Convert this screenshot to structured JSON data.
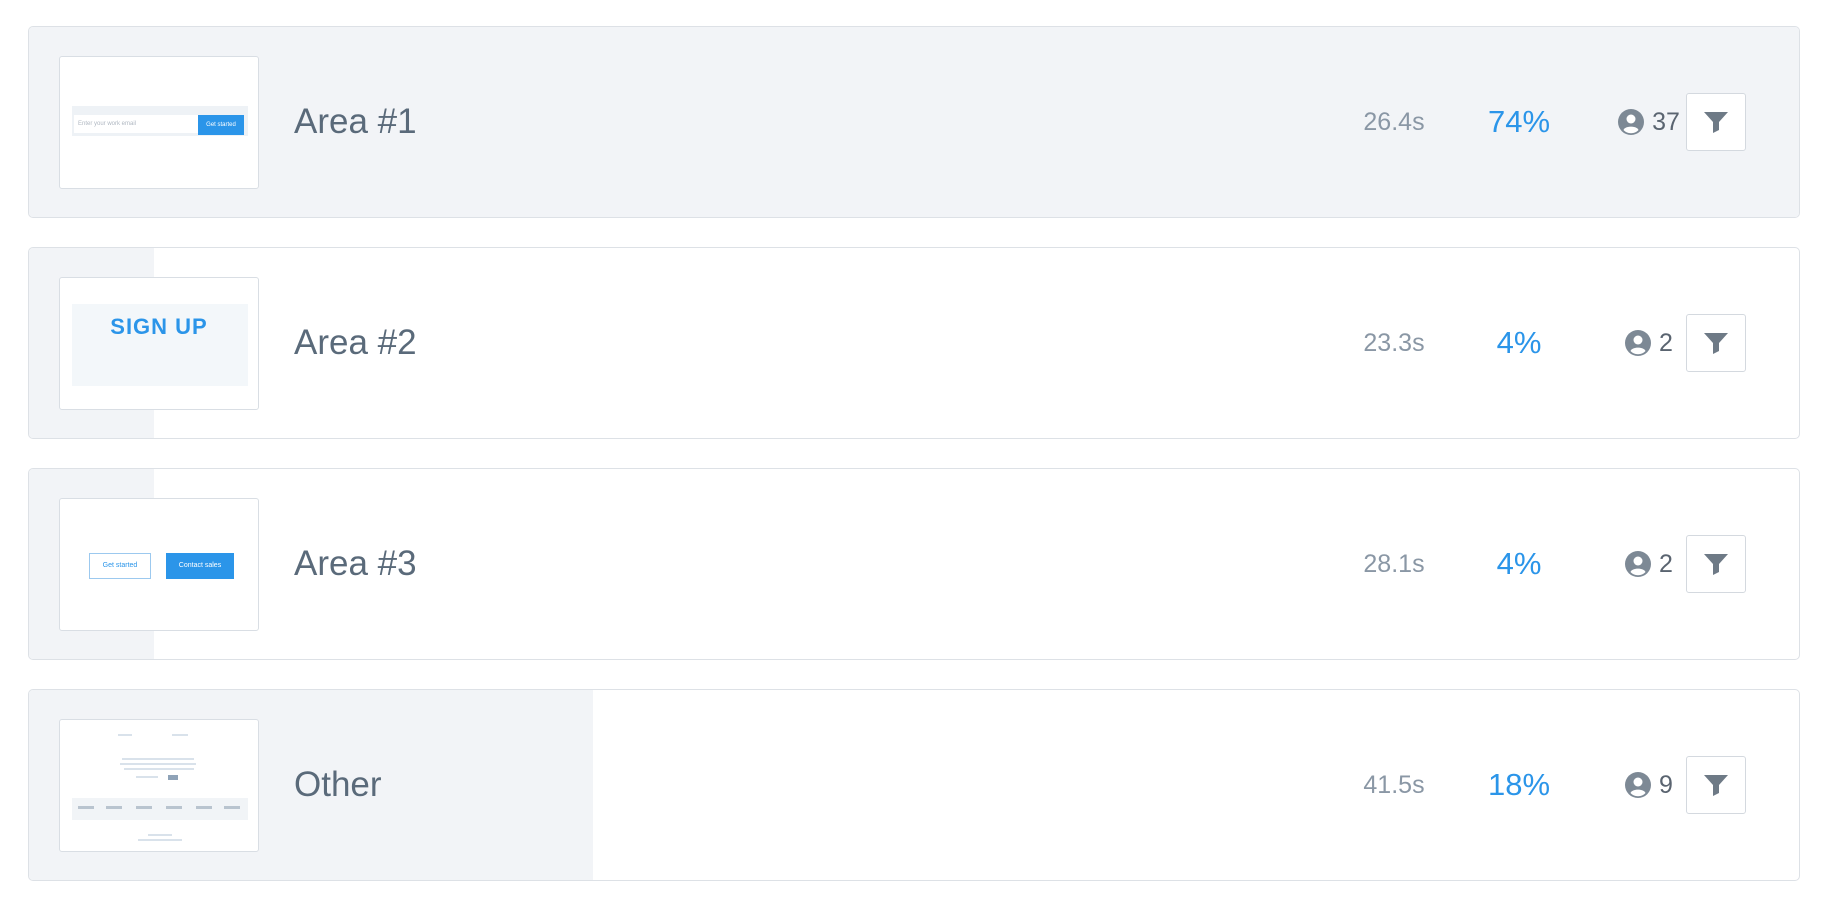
{
  "rows": [
    {
      "name": "Area #1",
      "time": "26.4s",
      "percent": "74%",
      "users": "37",
      "share": 0.74,
      "thumbnail": {
        "input_placeholder": "Enter your work email",
        "button_label": "Get started"
      }
    },
    {
      "name": "Area #2",
      "time": "23.3s",
      "percent": "4%",
      "users": "2",
      "share": 0.04,
      "thumbnail": {
        "text": "SIGN UP"
      }
    },
    {
      "name": "Area #3",
      "time": "28.1s",
      "percent": "4%",
      "users": "2",
      "share": 0.04,
      "thumbnail": {
        "secondary_label": "Get started",
        "primary_label": "Contact sales"
      }
    },
    {
      "name": "Other",
      "time": "41.5s",
      "percent": "18%",
      "users": "9",
      "share": 0.18,
      "thumbnail": {}
    }
  ],
  "icons": {
    "users": "user-circle-icon",
    "filter": "filter-icon"
  },
  "colors": {
    "accent": "#2b95e9",
    "bar": "#f2f4f7",
    "muted_text": "#8a97a5"
  }
}
